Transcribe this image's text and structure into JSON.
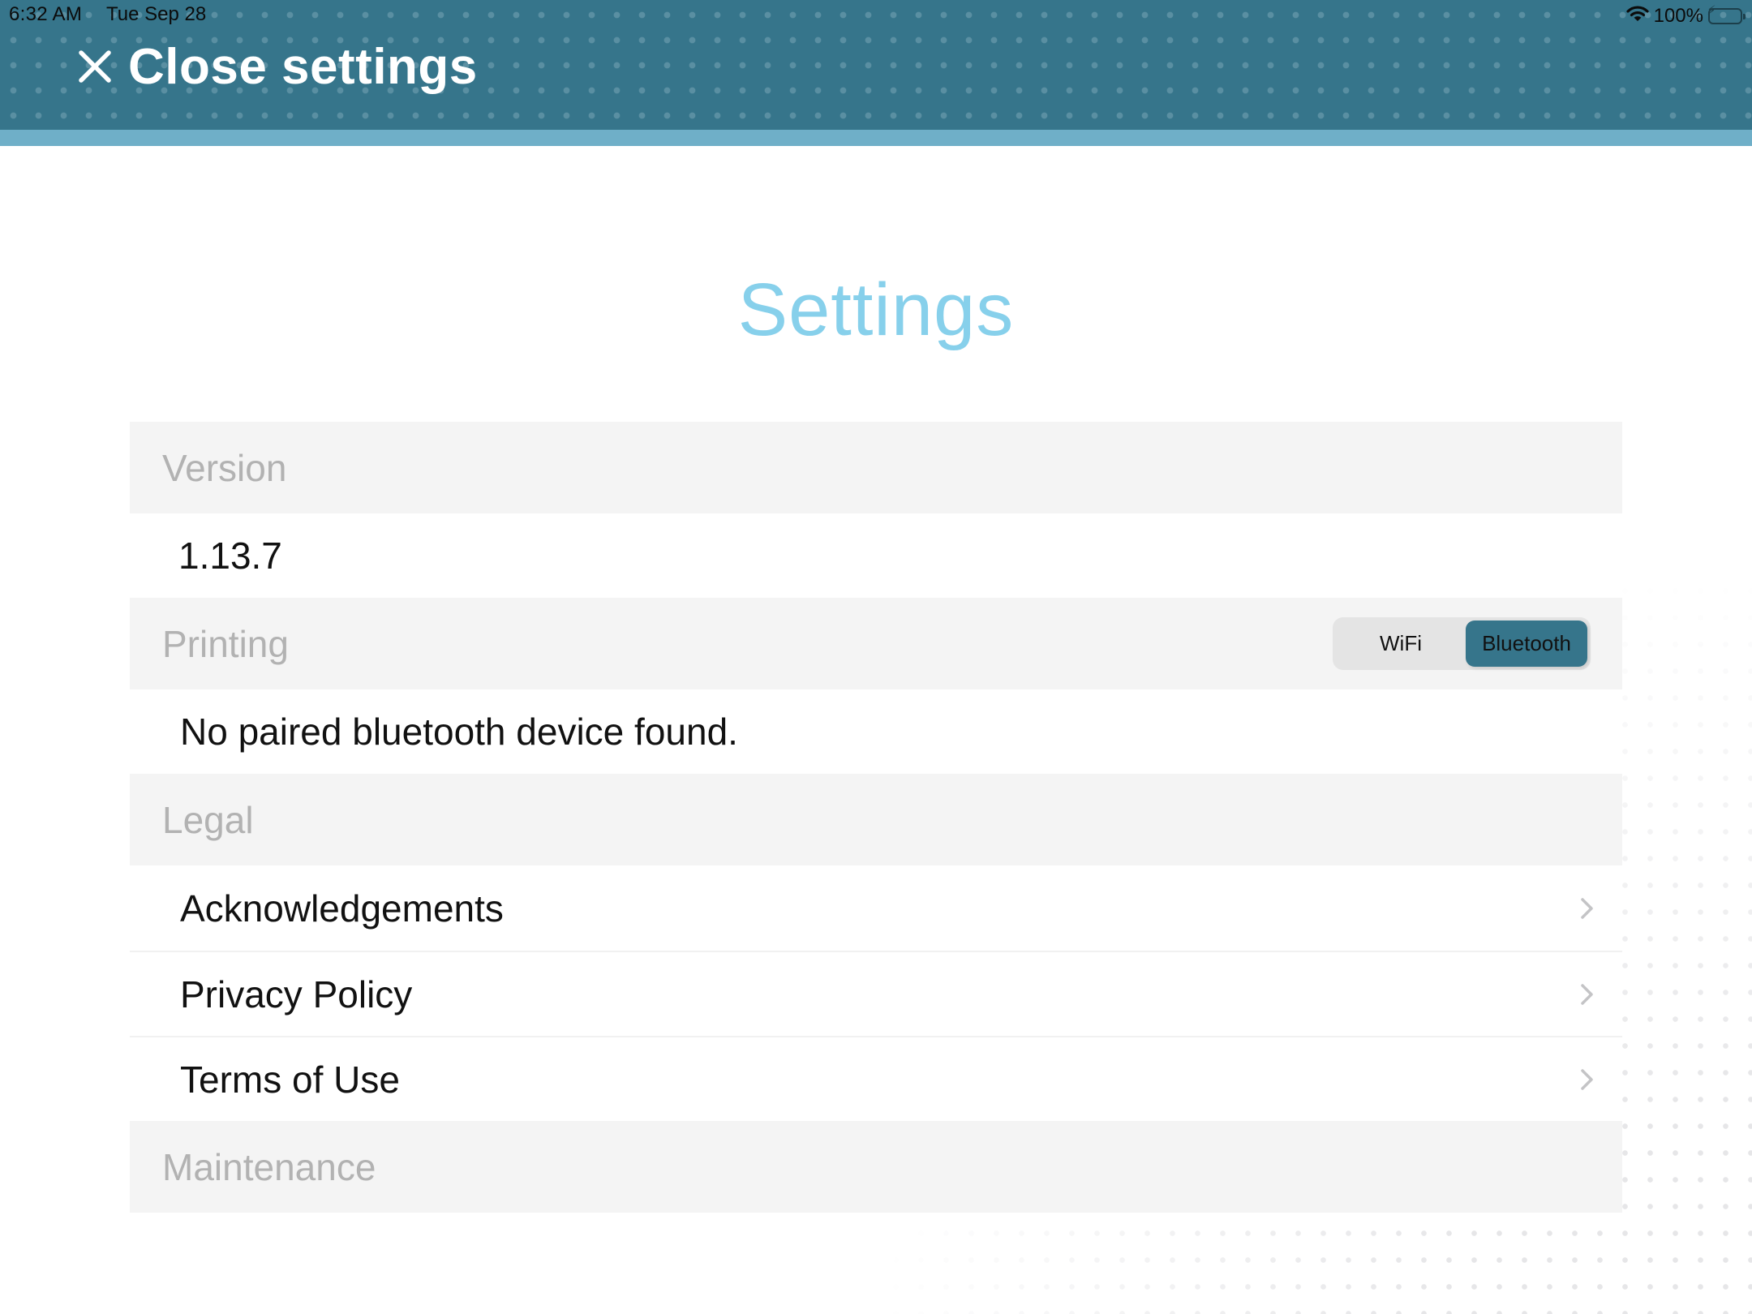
{
  "status_bar": {
    "time": "6:32 AM",
    "date": "Tue Sep 28",
    "battery_percent": "100%",
    "wifi_icon": "wifi-icon",
    "battery_icon": "battery-charging-icon",
    "battery_level": 1.0
  },
  "header": {
    "close_label": "Close settings",
    "close_icon": "close-icon",
    "colors": {
      "bar": "#36758b",
      "accent_strip": "#6fafc8"
    }
  },
  "page": {
    "title": "Settings",
    "title_color": "#87d0eb"
  },
  "sections": {
    "version": {
      "label": "Version",
      "value": "1.13.7"
    },
    "printing": {
      "label": "Printing",
      "toggle": {
        "options": [
          "WiFi",
          "Bluetooth"
        ],
        "selected": "Bluetooth",
        "selected_color": "#36758b"
      },
      "status": "No paired bluetooth device found."
    },
    "legal": {
      "label": "Legal",
      "items": [
        {
          "label": "Acknowledgements",
          "icon": "chevron-right-icon"
        },
        {
          "label": "Privacy Policy",
          "icon": "chevron-right-icon"
        },
        {
          "label": "Terms of Use",
          "icon": "chevron-right-icon"
        }
      ]
    },
    "maintenance": {
      "label": "Maintenance"
    }
  }
}
